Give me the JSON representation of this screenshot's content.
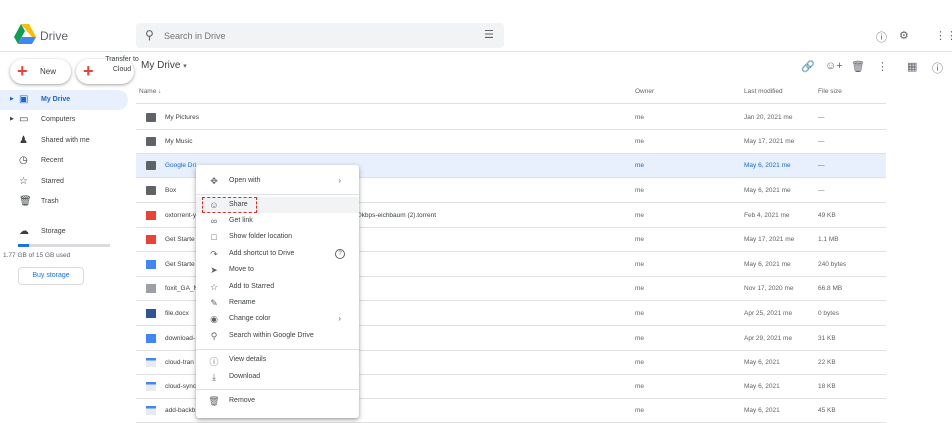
{
  "app": {
    "title": "Drive"
  },
  "search": {
    "placeholder": "Search in Drive"
  },
  "buttons": {
    "new_label": "New",
    "transfer_label": "Transfer to Cloud"
  },
  "header": {
    "title": "My Drive"
  },
  "sidebar": {
    "items": [
      {
        "label": "My Drive",
        "icon": "drive-icon"
      },
      {
        "label": "Computers",
        "icon": "computer-icon"
      },
      {
        "label": "Shared with me",
        "icon": "people-icon"
      },
      {
        "label": "Recent",
        "icon": "clock-icon"
      },
      {
        "label": "Starred",
        "icon": "star-icon"
      },
      {
        "label": "Trash",
        "icon": "trash-icon"
      }
    ],
    "storage_label": "Storage",
    "storage_used": "1.77 GB of 15 GB used",
    "storage_fraction": 0.118,
    "buy_storage": "Buy storage"
  },
  "columns": {
    "name": "Name",
    "owner": "Owner",
    "modified": "Last modified",
    "size": "File size"
  },
  "files": [
    {
      "name": "My Pictures",
      "owner": "me",
      "modified": "Jan 20, 2021",
      "by": "me",
      "size": "—",
      "type": "folder"
    },
    {
      "name": "My Music",
      "owner": "me",
      "modified": "May 17, 2021",
      "by": "me",
      "size": "—",
      "type": "folder"
    },
    {
      "name": "Google Dri",
      "owner": "me",
      "modified": "May 6, 2021",
      "by": "me",
      "size": "—",
      "type": "folder"
    },
    {
      "name": "Box",
      "owner": "me",
      "modified": "May 6, 2021",
      "by": "me",
      "size": "—",
      "type": "folder"
    },
    {
      "name": "oxtorrent-y",
      "name_tail": "0kbps-eichbaum (2).torrent",
      "owner": "me",
      "modified": "Feb 4, 2021",
      "by": "me",
      "size": "49 KB",
      "type": "torrent"
    },
    {
      "name": "Get Starte",
      "owner": "me",
      "modified": "May 17, 2021",
      "by": "me",
      "size": "1.1 MB",
      "type": "pdf"
    },
    {
      "name": "Get Starte",
      "owner": "me",
      "modified": "May 6, 2021",
      "by": "me",
      "size": "240 bytes",
      "type": "doc"
    },
    {
      "name": "foxit_GA_N",
      "owner": "me",
      "modified": "Nov 17, 2020",
      "by": "me",
      "size": "66.8 MB",
      "type": "archive"
    },
    {
      "name": "file.docx",
      "owner": "me",
      "modified": "Apr 25, 2021",
      "by": "me",
      "size": "0 bytes",
      "type": "word"
    },
    {
      "name": "download-",
      "owner": "me",
      "modified": "Apr 29, 2021",
      "by": "me",
      "size": "31 KB",
      "type": "doc"
    },
    {
      "name": "cloud-tran",
      "owner": "me",
      "modified": "May 6, 2021",
      "by": "",
      "size": "22 KB",
      "type": "image"
    },
    {
      "name": "cloud-sync",
      "owner": "me",
      "modified": "May 6, 2021",
      "by": "",
      "size": "18 KB",
      "type": "image"
    },
    {
      "name": "add-backb",
      "owner": "me",
      "modified": "May 6, 2021",
      "by": "",
      "size": "45 KB",
      "type": "image"
    }
  ],
  "context_menu": [
    {
      "label": "Open with",
      "icon": "open-with-icon",
      "arrow": "›"
    },
    {
      "label": "Share",
      "icon": "share-person-icon"
    },
    {
      "label": "Get link",
      "icon": "link-icon"
    },
    {
      "label": "Show folder location",
      "icon": "folder-icon"
    },
    {
      "label": "Add shortcut to Drive",
      "icon": "shortcut-icon",
      "help": "?"
    },
    {
      "label": "Move to",
      "icon": "move-icon"
    },
    {
      "label": "Add to Starred",
      "icon": "star-icon"
    },
    {
      "label": "Rename",
      "icon": "pencil-icon"
    },
    {
      "label": "Change color",
      "icon": "palette-icon",
      "arrow": "›"
    },
    {
      "label": "Search within Google Drive",
      "icon": "search-icon"
    },
    {
      "label": "View details",
      "icon": "info-icon"
    },
    {
      "label": "Download",
      "icon": "download-icon"
    },
    {
      "label": "Remove",
      "icon": "trash-icon"
    }
  ],
  "colors": {
    "accent": "#1a73e8",
    "selection": "#e8f0fe",
    "highlight_box": "#d93025"
  }
}
